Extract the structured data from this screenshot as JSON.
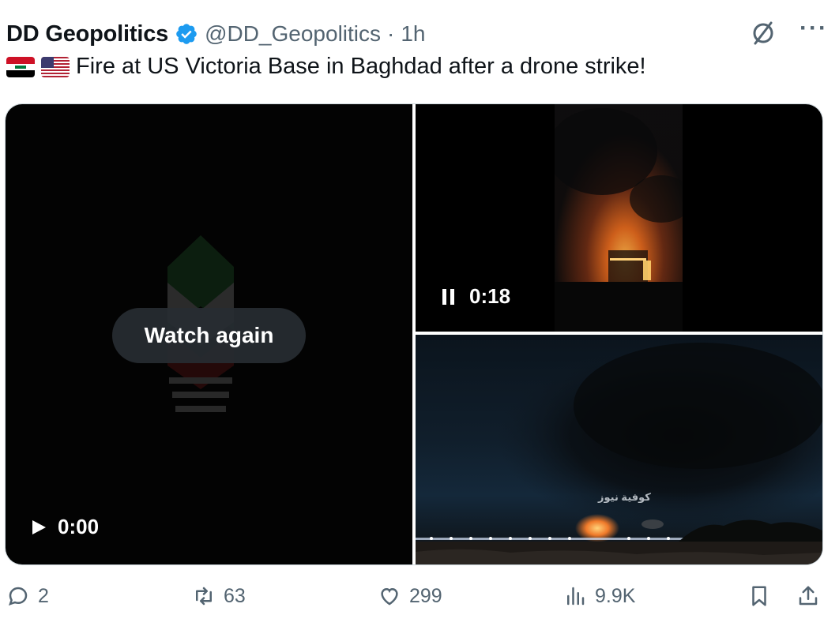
{
  "tweet": {
    "author_name": "DD Geopolitics",
    "handle": "@DD_Geopolitics",
    "separator": "·",
    "time": "1h",
    "more_label": "···",
    "text": "Fire at US Victoria Base in Baghdad after a drone strike!",
    "flags": [
      "iraq-flag",
      "us-flag"
    ]
  },
  "media": {
    "left_video": {
      "watch_again_label": "Watch again",
      "timestamp": "0:00",
      "state": "ended"
    },
    "top_right_video": {
      "timestamp": "0:18",
      "state": "playing"
    },
    "bottom_right_image": {
      "watermark": "كوفية نيوز"
    }
  },
  "actions": {
    "replies": "2",
    "reposts": "63",
    "likes": "299",
    "views": "9.9K"
  },
  "colors": {
    "text_primary": "#0f1419",
    "text_secondary": "#536471",
    "verified_blue": "#1d9bf0",
    "border": "#cfd9de"
  },
  "icons": [
    "verified-badge-icon",
    "grok-icon",
    "more-icon",
    "play-icon",
    "pause-icon",
    "reply-icon",
    "repost-icon",
    "like-icon",
    "views-icon",
    "bookmark-icon",
    "share-icon"
  ]
}
